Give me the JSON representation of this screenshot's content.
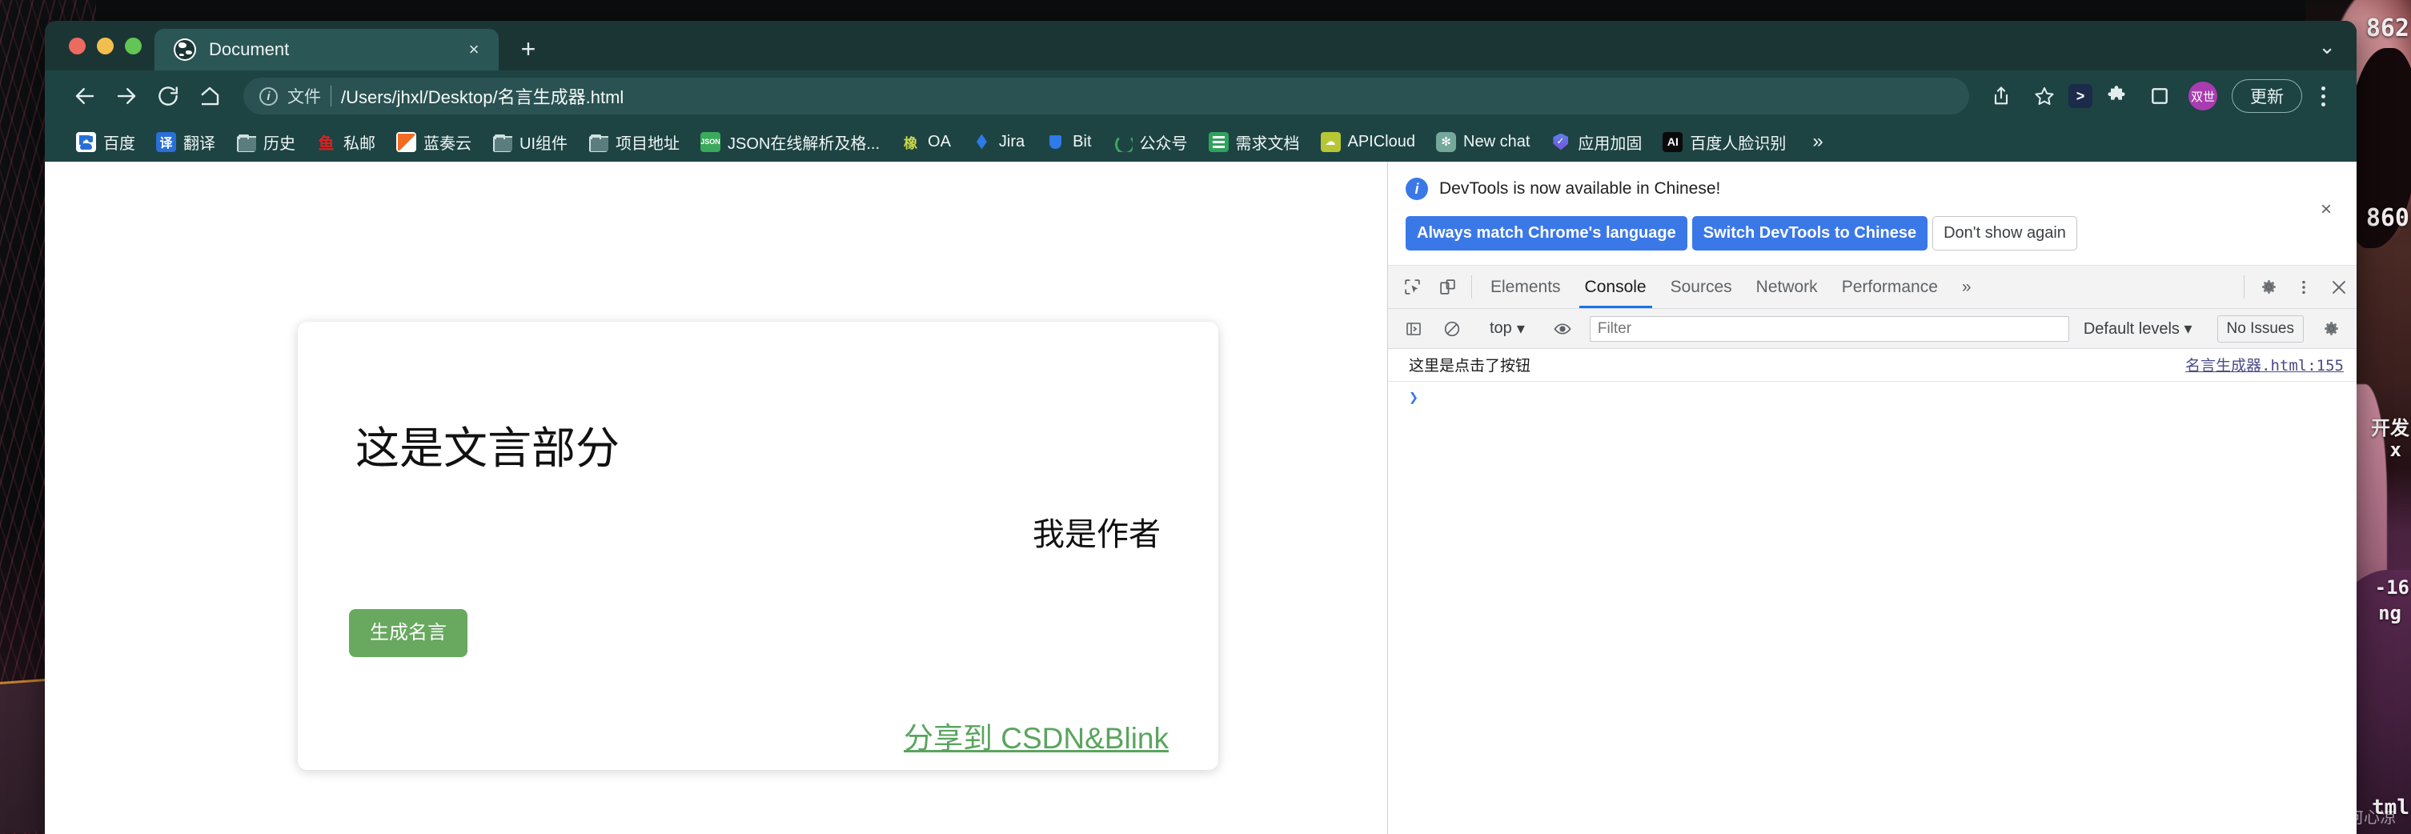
{
  "window": {
    "traffic_lights": [
      "close",
      "minimize",
      "maximize"
    ]
  },
  "tab": {
    "title": "Document",
    "close_label": "×",
    "newtab_label": "+",
    "list_chevron": "⌄"
  },
  "toolbar": {
    "back": "←",
    "forward": "→",
    "reload": "↻",
    "home": "⌂",
    "info": "i",
    "scheme_label": "文件",
    "url": "/Users/jhxl/Desktop/名言生成器.html",
    "share": "share-icon",
    "bookmark_star": "☆",
    "avatar_label": "双世",
    "update_label": "更新"
  },
  "bookmarks": {
    "overflow_label": "»",
    "items": [
      {
        "label": "百度",
        "icon": "baidu-icon"
      },
      {
        "label": "翻译",
        "icon": "translate-icon",
        "glyph": "译"
      },
      {
        "label": "历史",
        "icon": "folder-icon"
      },
      {
        "label": "私邮",
        "icon": "mail-icon",
        "glyph": "鱼"
      },
      {
        "label": "蓝奏云",
        "icon": "lanzou-icon"
      },
      {
        "label": "UI组件",
        "icon": "folder-icon"
      },
      {
        "label": "项目地址",
        "icon": "folder-icon"
      },
      {
        "label": "JSON在线解析及格...",
        "icon": "json-icon",
        "glyph": "JSON"
      },
      {
        "label": "OA",
        "icon": "oa-icon",
        "glyph": "橡"
      },
      {
        "label": "Jira",
        "icon": "jira-icon"
      },
      {
        "label": "Bit",
        "icon": "bit-icon"
      },
      {
        "label": "公众号",
        "icon": "wechat-official-icon"
      },
      {
        "label": "需求文档",
        "icon": "sheets-icon"
      },
      {
        "label": "APICloud",
        "icon": "apicloud-icon",
        "glyph": "☁"
      },
      {
        "label": "New chat",
        "icon": "openai-icon",
        "glyph": "✻"
      },
      {
        "label": "应用加固",
        "icon": "shield-icon"
      },
      {
        "label": "百度人脸识别",
        "icon": "ai-icon",
        "glyph": "AI"
      }
    ]
  },
  "page": {
    "quote_text": "这是文言部分",
    "author": "我是作者",
    "generate_button": "生成名言",
    "share_link": "分享到 CSDN&Blink",
    "accent_green": "#68a95f",
    "link_green": "#5aa45f"
  },
  "devtools": {
    "notice": {
      "message": "DevTools is now available in Chinese!",
      "buttons": [
        {
          "label": "Always match Chrome's language",
          "style": "primary"
        },
        {
          "label": "Switch DevTools to Chinese",
          "style": "primary"
        },
        {
          "label": "Don't show again",
          "style": "plain"
        }
      ],
      "close_label": "×"
    },
    "tabs": [
      {
        "label": "Elements",
        "active": false
      },
      {
        "label": "Console",
        "active": true
      },
      {
        "label": "Sources",
        "active": false
      },
      {
        "label": "Network",
        "active": false
      },
      {
        "label": "Performance",
        "active": false
      }
    ],
    "tabs_overflow": "»",
    "settings_icon": "gear-icon",
    "more_icon": "kebab-icon",
    "close_icon": "close-icon",
    "filterbar": {
      "sidebar_toggle": "sidebar-toggle-icon",
      "clear_console": "clear-console-icon",
      "context": "top",
      "context_caret": "▾",
      "eye_icon": "live-expression-icon",
      "filter_placeholder": "Filter",
      "filter_value": "",
      "levels_label": "Default levels",
      "levels_caret": "▾",
      "issues_label": "No Issues",
      "settings_icon": "gear-icon"
    },
    "console_logs": [
      {
        "message": "这里是点击了按钮",
        "source": "名言生成器.html:155"
      }
    ],
    "prompt_caret": "❯"
  },
  "desktop": {
    "texts": [
      "862",
      "860",
      "开发",
      "x",
      "-16",
      "ng",
      "tml"
    ],
    "watermark": "CSDN @几何心凉"
  }
}
